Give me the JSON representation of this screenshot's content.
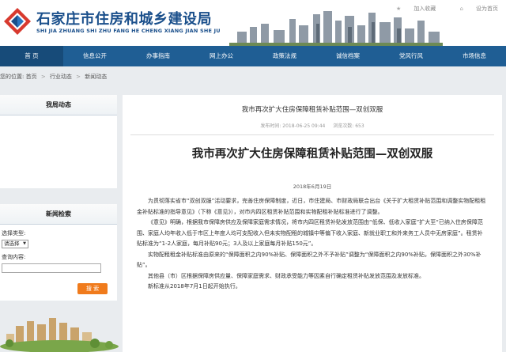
{
  "header": {
    "title_cn": "石家庄市住房和城乡建设局",
    "title_en": "SHI JIA ZHUANG SHI ZHU FANG HE CHENG XIANG JIAN SHE JU",
    "links": [
      "加入收藏",
      "设为首页"
    ]
  },
  "nav": {
    "items": [
      "首 页",
      "信息公开",
      "办事指南",
      "网上办公",
      "政策法规",
      "诚信档案",
      "党风行风",
      "市场信息"
    ]
  },
  "breadcrumb": {
    "prefix": "您的位置:",
    "items": [
      "首页",
      "行业动态",
      "新闻动态"
    ]
  },
  "sidebar": {
    "news_title": "我局动态",
    "search_title": "新闻检索",
    "type_label": "选择类型:",
    "type_value": "请选择",
    "keyword_label": "查询内容:",
    "search_button": "搜 索"
  },
  "article": {
    "small_title": "我市再次扩大住房保障租赁补贴范围—双创双服",
    "meta_time": "发布时间: 2018-06-25 09:44",
    "meta_views": "浏览次数: 653",
    "title": "我市再次扩大住房保障租赁补贴范围—双创双服",
    "date": "2018年6月19日",
    "paragraphs": [
      "为贯彻落实省市“双创双服”活动要求，完善住房保障制度，近日，市住建局、市财政局联合出台《关于扩大租赁补贴范围和调整实物配租租金补贴标准的指导意见》（下称《意见》），对市内四区租赁补贴范围和实物配租补贴标准进行了调整。",
      "《意见》明确，根据我市保障房供应及保障家庭需求情况，将市内四区租赁补贴发放范围由“低保、低收入家庭”扩大至“已纳入住房保障范围、家庭人均年收入低于市区上年度人均可支配收入但未实物配租的城镇中等偏下收入家庭、新就业职工和外来务工人员中无房家庭”。租赁补贴标准为“1-2人家庭，每月补贴90元；3人及以上家庭每月补贴150元”。",
      "实物配租租金补贴标准由原来的“保障面积之内90%补贴、保障面积之外不予补贴”调整为“保障面积之内90%补贴，保障面积之外30%补贴”。",
      "其他县（市）区根据保障房供应量、保障家庭需求、财政承受能力等因素自行确定租赁补贴发放范围及发放标准。",
      "新标准从2018年7月1日起开始执行。"
    ]
  },
  "colors": {
    "nav_bg": "#1f5e94",
    "logo_blue": "#1a4f8b",
    "logo_red": "#d83a2f",
    "search_button": "#f07b1c"
  }
}
